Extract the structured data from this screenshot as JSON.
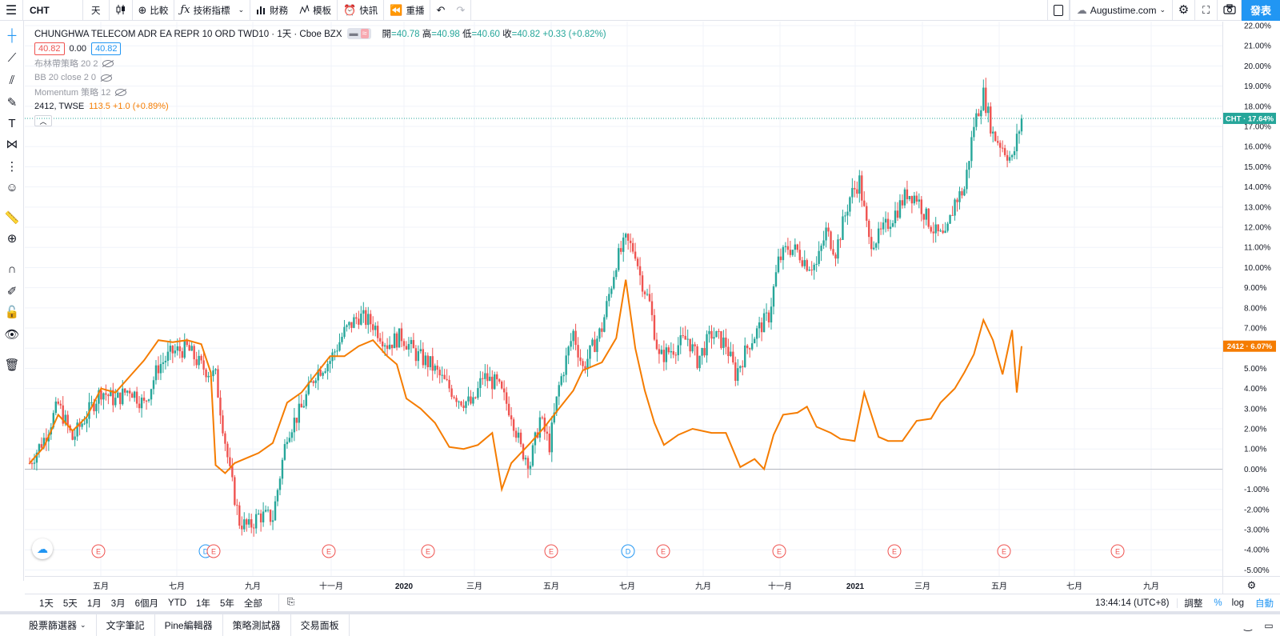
{
  "toolbar": {
    "symbol": "CHT",
    "interval": "天",
    "compare": "比較",
    "indicators": "技術指標",
    "financials": "財務",
    "templates": "模板",
    "alerts": "快訊",
    "replay": "重播",
    "site": "Augustime.com",
    "publish": "發表"
  },
  "legend": {
    "title": "CHUNGHWA TELECOM ADR EA REPR 10 ORD TWD10 · 1天 · Cboe BZX",
    "open_label": "開",
    "open": "=40.78",
    "high_label": "高",
    "high": "=40.98",
    "low_label": "低",
    "low": "=40.60",
    "close_label": "收",
    "close": "=40.82",
    "change": "+0.33 (+0.82%)",
    "bid": "40.82",
    "spread": "0.00",
    "ask": "40.82",
    "indicators": [
      "布林帶策略 20 2",
      "BB 20 close 2 0",
      "Momentum 策略 12"
    ],
    "compare_symbol": "2412, TWSE",
    "compare_values": "113.5 +1.0 (+0.89%)"
  },
  "price_labels": {
    "cht": "CHT · 17.64%",
    "tw2412": "2412 · 6.07%"
  },
  "chart_data": {
    "type": "line",
    "ylabel": "",
    "y_unit": "%",
    "ylim": [
      -5.3,
      22.2
    ],
    "y_ticks": [
      "22.00%",
      "21.00%",
      "20.00%",
      "19.00%",
      "18.00%",
      "17.00%",
      "16.00%",
      "15.00%",
      "14.00%",
      "13.00%",
      "12.00%",
      "11.00%",
      "10.00%",
      "9.00%",
      "8.00%",
      "7.00%",
      "6.00%",
      "5.00%",
      "4.00%",
      "3.00%",
      "2.00%",
      "1.00%",
      "0.00%",
      "-1.00%",
      "-2.00%",
      "-3.00%",
      "-4.00%",
      "-5.00%"
    ],
    "x_ticks": [
      "五月",
      "七月",
      "九月",
      "十一月",
      "2020",
      "三月",
      "五月",
      "七月",
      "九月",
      "十一月",
      "2021",
      "三月",
      "五月",
      "七月",
      "九月"
    ],
    "series": [
      {
        "name": "CHT",
        "color": "#26a69a",
        "style": "candles",
        "points": [
          [
            0,
            0.3
          ],
          [
            6,
            1.5
          ],
          [
            12,
            3.2
          ],
          [
            18,
            1.5
          ],
          [
            24,
            2.7
          ],
          [
            30,
            3.9
          ],
          [
            36,
            3.4
          ],
          [
            42,
            4.0
          ],
          [
            48,
            3.2
          ],
          [
            54,
            5.1
          ],
          [
            60,
            5.8
          ],
          [
            66,
            6.0
          ],
          [
            72,
            5.1
          ],
          [
            78,
            4.6
          ],
          [
            84,
            -0.2
          ],
          [
            88,
            -2.6
          ],
          [
            92,
            -2.9
          ],
          [
            96,
            -2.3
          ],
          [
            102,
            -2.4
          ],
          [
            108,
            1.8
          ],
          [
            114,
            3.0
          ],
          [
            120,
            4.8
          ],
          [
            126,
            5.4
          ],
          [
            132,
            6.8
          ],
          [
            138,
            7.6
          ],
          [
            144,
            7.2
          ],
          [
            150,
            6.2
          ],
          [
            156,
            6.6
          ],
          [
            162,
            5.7
          ],
          [
            168,
            5.2
          ],
          [
            174,
            4.3
          ],
          [
            180,
            3.5
          ],
          [
            186,
            3.2
          ],
          [
            190,
            4.6
          ],
          [
            196,
            4.2
          ],
          [
            202,
            2.8
          ],
          [
            206,
            1.0
          ],
          [
            210,
            0.3
          ],
          [
            214,
            2.5
          ],
          [
            218,
            1.2
          ],
          [
            222,
            4.1
          ],
          [
            228,
            6.8
          ],
          [
            232,
            5.0
          ],
          [
            236,
            6.0
          ],
          [
            240,
            7.0
          ],
          [
            246,
            10.3
          ],
          [
            250,
            11.3
          ],
          [
            254,
            10.8
          ],
          [
            256,
            9.6
          ],
          [
            260,
            8.2
          ],
          [
            264,
            5.5
          ],
          [
            270,
            6.0
          ],
          [
            276,
            6.5
          ],
          [
            280,
            5.4
          ],
          [
            286,
            6.7
          ],
          [
            292,
            6.2
          ],
          [
            296,
            4.7
          ],
          [
            302,
            6.3
          ],
          [
            306,
            7.0
          ],
          [
            310,
            7.6
          ],
          [
            314,
            10.3
          ],
          [
            318,
            11.0
          ],
          [
            322,
            10.8
          ],
          [
            326,
            10.2
          ],
          [
            330,
            10.1
          ],
          [
            334,
            11.8
          ],
          [
            338,
            10.8
          ],
          [
            344,
            13.5
          ],
          [
            348,
            14.3
          ],
          [
            352,
            11.3
          ],
          [
            356,
            11.5
          ],
          [
            360,
            12.2
          ],
          [
            364,
            12.9
          ],
          [
            368,
            13.7
          ],
          [
            372,
            13.5
          ],
          [
            376,
            12.5
          ],
          [
            380,
            11.7
          ],
          [
            384,
            11.4
          ],
          [
            388,
            13.3
          ],
          [
            392,
            13.9
          ],
          [
            396,
            17.1
          ],
          [
            400,
            18.6
          ],
          [
            404,
            16.6
          ],
          [
            408,
            16.0
          ],
          [
            412,
            15.3
          ],
          [
            416,
            17.4
          ]
        ]
      },
      {
        "name": "2412",
        "color": "#f57c00",
        "style": "line",
        "points": [
          [
            0,
            0.3
          ],
          [
            6,
            1.1
          ],
          [
            12,
            2.7
          ],
          [
            18,
            1.9
          ],
          [
            24,
            2.6
          ],
          [
            30,
            4.0
          ],
          [
            36,
            3.8
          ],
          [
            42,
            4.6
          ],
          [
            48,
            5.4
          ],
          [
            54,
            6.4
          ],
          [
            60,
            6.3
          ],
          [
            66,
            6.4
          ],
          [
            72,
            6.2
          ],
          [
            76,
            4.8
          ],
          [
            78,
            0.2
          ],
          [
            82,
            -0.2
          ],
          [
            86,
            0.3
          ],
          [
            90,
            0.5
          ],
          [
            96,
            0.8
          ],
          [
            102,
            1.3
          ],
          [
            108,
            3.3
          ],
          [
            114,
            3.8
          ],
          [
            120,
            4.7
          ],
          [
            126,
            5.6
          ],
          [
            132,
            5.6
          ],
          [
            138,
            6.1
          ],
          [
            144,
            6.4
          ],
          [
            150,
            5.6
          ],
          [
            154,
            5.2
          ],
          [
            158,
            3.5
          ],
          [
            164,
            3.0
          ],
          [
            170,
            2.3
          ],
          [
            176,
            1.1
          ],
          [
            182,
            1.0
          ],
          [
            188,
            1.2
          ],
          [
            194,
            1.8
          ],
          [
            198,
            -1.0
          ],
          [
            202,
            0.3
          ],
          [
            206,
            0.8
          ],
          [
            210,
            1.3
          ],
          [
            216,
            2.1
          ],
          [
            222,
            3.0
          ],
          [
            228,
            3.9
          ],
          [
            232,
            4.9
          ],
          [
            240,
            5.3
          ],
          [
            246,
            6.5
          ],
          [
            250,
            9.4
          ],
          [
            254,
            6.0
          ],
          [
            258,
            3.9
          ],
          [
            262,
            2.3
          ],
          [
            266,
            1.2
          ],
          [
            272,
            1.7
          ],
          [
            278,
            2.0
          ],
          [
            286,
            1.8
          ],
          [
            292,
            1.8
          ],
          [
            298,
            0.1
          ],
          [
            304,
            0.5
          ],
          [
            308,
            0.0
          ],
          [
            312,
            1.7
          ],
          [
            316,
            2.7
          ],
          [
            322,
            2.8
          ],
          [
            326,
            3.1
          ],
          [
            330,
            2.1
          ],
          [
            336,
            1.8
          ],
          [
            340,
            1.5
          ],
          [
            346,
            1.4
          ],
          [
            350,
            3.8
          ],
          [
            356,
            1.6
          ],
          [
            360,
            1.4
          ],
          [
            366,
            1.4
          ],
          [
            372,
            2.4
          ],
          [
            378,
            2.5
          ],
          [
            382,
            3.3
          ],
          [
            388,
            4.0
          ],
          [
            392,
            4.8
          ],
          [
            396,
            5.7
          ],
          [
            400,
            7.4
          ],
          [
            404,
            6.4
          ],
          [
            408,
            4.7
          ],
          [
            412,
            6.9
          ],
          [
            414,
            3.8
          ],
          [
            416,
            6.1
          ]
        ]
      }
    ],
    "events": [
      {
        "label": "E",
        "type": "earnings"
      },
      {
        "label": "D",
        "type": "dividend"
      },
      {
        "label": "E",
        "type": "earnings"
      },
      {
        "label": "E",
        "type": "earnings"
      },
      {
        "label": "E",
        "type": "earnings"
      },
      {
        "label": "E",
        "type": "earnings"
      },
      {
        "label": "D",
        "type": "dividend"
      },
      {
        "label": "E",
        "type": "earnings"
      },
      {
        "label": "E",
        "type": "earnings"
      },
      {
        "label": "E",
        "type": "earnings"
      },
      {
        "label": "E",
        "type": "earnings"
      },
      {
        "label": "E",
        "type": "earnings"
      }
    ]
  },
  "ranges": [
    "1天",
    "5天",
    "1月",
    "3月",
    "6個月",
    "YTD",
    "1年",
    "5年",
    "全部"
  ],
  "status": {
    "time": "13:44:14 (UTC+8)",
    "adjust": "調整",
    "percent": "%",
    "log": "log",
    "auto": "自動"
  },
  "bottom_tabs": [
    "股票篩選器",
    "文字筆記",
    "Pine編輯器",
    "策略測試器",
    "交易面板"
  ]
}
